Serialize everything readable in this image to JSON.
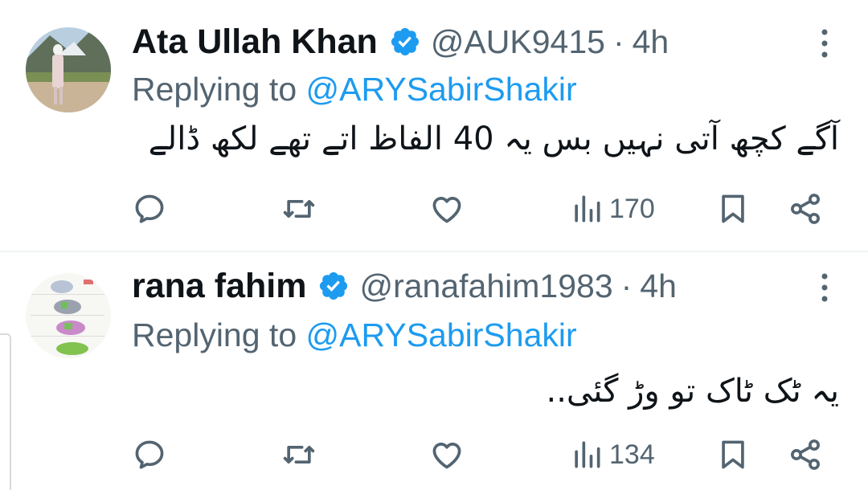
{
  "tweets": [
    {
      "name": "Ata Ullah Khan",
      "handle": "@AUK9415",
      "separator": "·",
      "time": "4h",
      "replying_prefix": "Replying to",
      "replying_to": "@ARYSabirShakir",
      "text": "آگے کچھ آتی نہیں بس یہ 40 الفاظ اتے تھے لکھ ڈالے",
      "views": "170",
      "avatar_icon": "profile-photo",
      "verified_icon": "verified-badge-icon"
    },
    {
      "name": "rana fahim",
      "handle": "@ranafahim1983",
      "separator": "·",
      "time": "4h",
      "replying_prefix": "Replying to",
      "replying_to": "@ARYSabirShakir",
      "text": "یہ ٹک ٹاک تو وڑ گئی..",
      "views": "134",
      "avatar_icon": "elephant-drawing-avatar",
      "verified_icon": "verified-badge-icon"
    }
  ],
  "colors": {
    "accent": "#1d9bf0",
    "secondary_text": "#536471",
    "primary_text": "#0f1419",
    "divider": "#eff3f4"
  }
}
